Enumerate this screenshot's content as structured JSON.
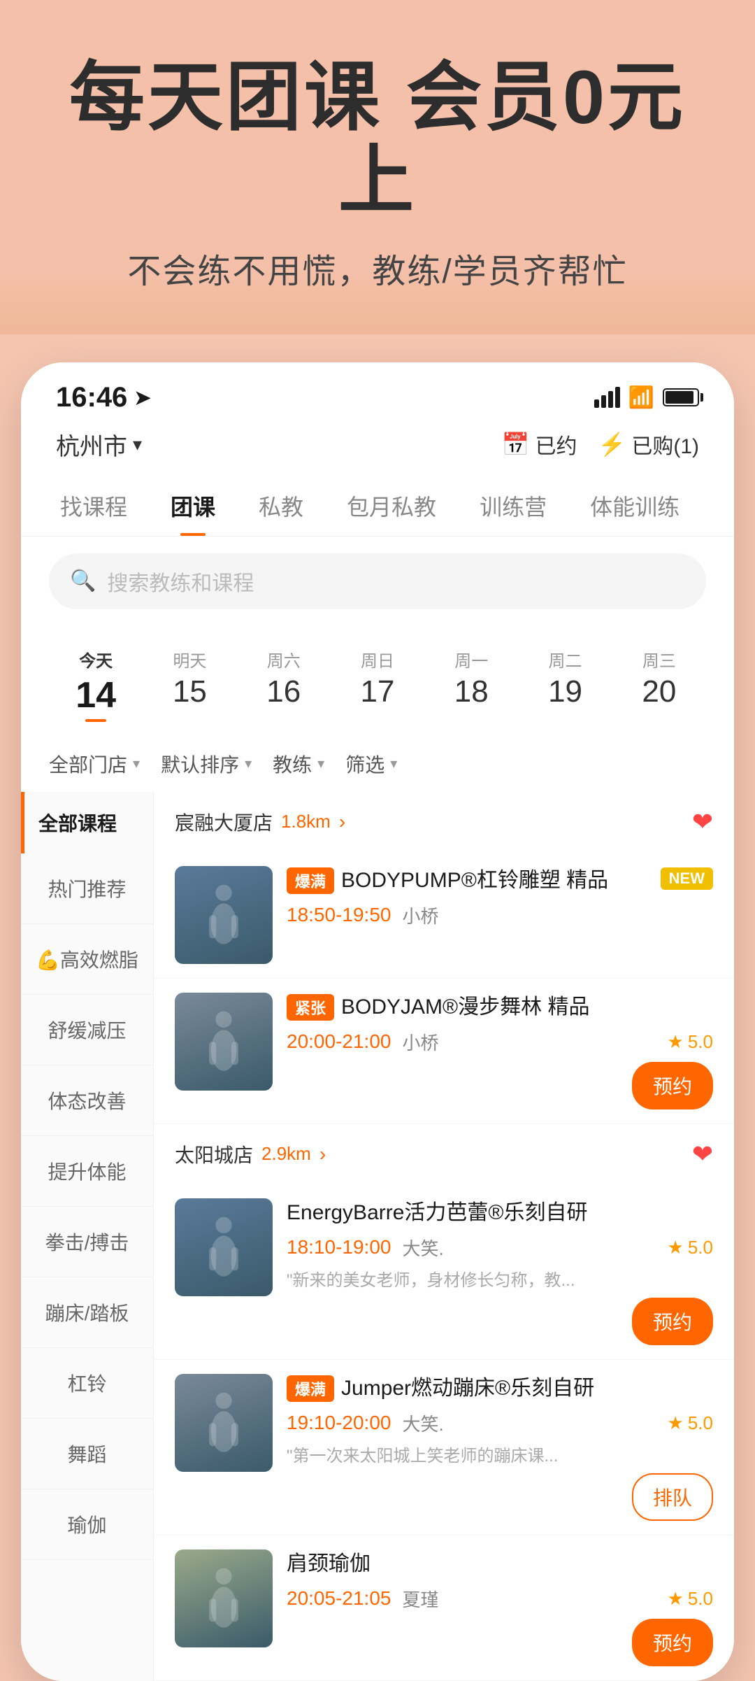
{
  "hero": {
    "title": "每天团课 会员0元上",
    "subtitle": "不会练不用慌，教练/学员齐帮忙"
  },
  "statusBar": {
    "time": "16:46",
    "location_icon": "navigation-icon"
  },
  "topNav": {
    "location": "杭州市",
    "location_arrow": "▼",
    "action1_icon": "calendar-check-icon",
    "action1_label": "已约",
    "action2_icon": "lightning-icon",
    "action2_label": "已购(1)"
  },
  "tabs": [
    {
      "label": "找课程",
      "active": false
    },
    {
      "label": "团课",
      "active": true
    },
    {
      "label": "私教",
      "active": false
    },
    {
      "label": "包月私教",
      "active": false
    },
    {
      "label": "训练营",
      "active": false
    },
    {
      "label": "体能训练",
      "active": false
    }
  ],
  "search": {
    "placeholder": "搜索教练和课程"
  },
  "dates": [
    {
      "label": "今天",
      "num": "14",
      "active": true
    },
    {
      "label": "明天",
      "num": "15",
      "active": false
    },
    {
      "label": "周六",
      "num": "16",
      "active": false
    },
    {
      "label": "周日",
      "num": "17",
      "active": false
    },
    {
      "label": "周一",
      "num": "18",
      "active": false
    },
    {
      "label": "周二",
      "num": "19",
      "active": false
    },
    {
      "label": "周三",
      "num": "20",
      "active": false
    }
  ],
  "filters": [
    {
      "label": "全部门店",
      "hasArrow": true
    },
    {
      "label": "默认排序",
      "hasArrow": true
    },
    {
      "label": "教练",
      "hasArrow": true
    },
    {
      "label": "筛选",
      "hasArrow": true
    }
  ],
  "sidebar": {
    "header": "全部课程",
    "items": [
      {
        "label": "热门推荐"
      },
      {
        "label": "💪高效燃脂"
      },
      {
        "label": "舒缓减压"
      },
      {
        "label": "体态改善"
      },
      {
        "label": "提升体能"
      },
      {
        "label": "拳击/搏击"
      },
      {
        "label": "蹦床/踏板"
      },
      {
        "label": "杠铃"
      },
      {
        "label": "舞蹈"
      },
      {
        "label": "瑜伽"
      }
    ]
  },
  "stores": [
    {
      "name": "宸融大厦店",
      "distance": "1.8km",
      "favorited": true,
      "courses": [
        {
          "badge": "爆满",
          "badge_type": "hot",
          "name": "BODYPUMP®杠铃雕塑 精品",
          "time": "18:50-19:50",
          "coach": "小桥",
          "rating": null,
          "badge2": "NEW",
          "action": null
        },
        {
          "badge": "紧张",
          "badge_type": "tight",
          "name": "BODYJAM®漫步舞林 精品",
          "time": "20:00-21:00",
          "coach": "小桥",
          "rating": "5.0",
          "badge2": null,
          "action": "预约"
        }
      ]
    },
    {
      "name": "太阳城店",
      "distance": "2.9km",
      "favorited": true,
      "courses": [
        {
          "badge": null,
          "badge_type": null,
          "name": "EnergyBarre活力芭蕾®乐刻自研",
          "time": "18:10-19:00",
          "coach": "大笑.",
          "rating": "5.0",
          "badge2": null,
          "comment": "\"新来的美女老师，身材修长匀称，教...",
          "action": "预约"
        },
        {
          "badge": "爆满",
          "badge_type": "hot",
          "name": "Jumper燃动蹦床®乐刻自研",
          "time": "19:10-20:00",
          "coach": "大笑.",
          "rating": "5.0",
          "badge2": null,
          "comment": "\"第一次来太阳城上笑老师的蹦床课...",
          "action": "排队"
        },
        {
          "badge": null,
          "badge_type": null,
          "name": "肩颈瑜伽",
          "time": "20:05-21:05",
          "coach": "夏瑾",
          "rating": "5.0",
          "badge2": null,
          "comment": null,
          "action": "预约"
        }
      ]
    }
  ]
}
